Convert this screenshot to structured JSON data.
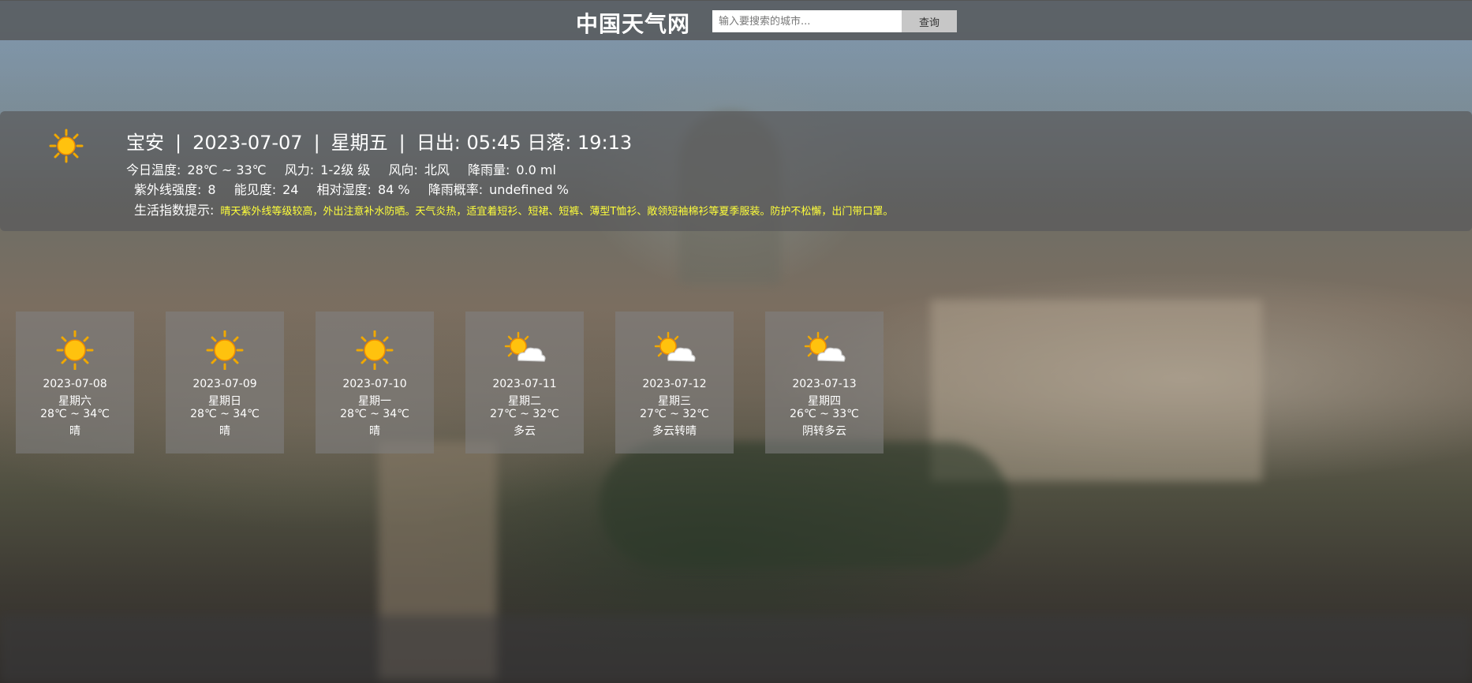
{
  "header": {
    "site_title": "中国天气网",
    "search_placeholder": "输入要搜索的城市...",
    "search_button": "查询"
  },
  "today": {
    "icon": "sun-icon",
    "city": "宝安",
    "date": "2023-07-07",
    "weekday": "星期五",
    "sun_times": "日出: 05:45 日落: 19:13",
    "temp_label": "今日温度:",
    "temp_value": "28℃ ~ 33℃",
    "wind_power_label": "风力:",
    "wind_power_value": "1-2级 级",
    "wind_dir_label": "风向:",
    "wind_dir_value": "北风",
    "rain_label": "降雨量:",
    "rain_value": "0.0 ml",
    "uv_label": "紫外线强度:",
    "uv_value": "8",
    "visibility_label": "能见度:",
    "visibility_value": "24",
    "humidity_label": "相对湿度:",
    "humidity_value": "84 %",
    "rain_prob_label": "降雨概率:",
    "rain_prob_value": "undefined %",
    "tips_label": "生活指数提示:",
    "tips_text": "晴天紫外线等级较高，外出注意补水防晒。天气炎热，适宜着短衫、短裙、短裤、薄型T恤衫、敞领短袖棉衫等夏季服装。防护不松懈，出门带口罩。"
  },
  "forecast": [
    {
      "icon": "sun-icon",
      "date": "2023-07-08",
      "weekday": "星期六",
      "temp": "28℃ ~ 34℃",
      "weather": "晴"
    },
    {
      "icon": "sun-icon",
      "date": "2023-07-09",
      "weekday": "星期日",
      "temp": "28℃ ~ 34℃",
      "weather": "晴"
    },
    {
      "icon": "sun-icon",
      "date": "2023-07-10",
      "weekday": "星期一",
      "temp": "28℃ ~ 34℃",
      "weather": "晴"
    },
    {
      "icon": "sun-cloud-icon",
      "date": "2023-07-11",
      "weekday": "星期二",
      "temp": "27℃ ~ 32℃",
      "weather": "多云"
    },
    {
      "icon": "sun-cloud-icon",
      "date": "2023-07-12",
      "weekday": "星期三",
      "temp": "27℃ ~ 32℃",
      "weather": "多云转晴"
    },
    {
      "icon": "sun-cloud-icon",
      "date": "2023-07-13",
      "weekday": "星期四",
      "temp": "26℃ ~ 33℃",
      "weather": "阴转多云"
    }
  ],
  "colors": {
    "tips_text": "#ffff3a",
    "panel_bg": "#5a5a5c",
    "sun": "#f5b400"
  }
}
